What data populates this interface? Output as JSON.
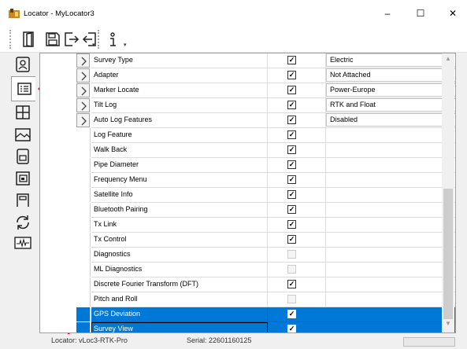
{
  "window": {
    "title": "Locator - MyLocator3",
    "minimize": "–",
    "maximize": "☐",
    "close": "✕"
  },
  "toolbar": {
    "items": [
      {
        "icon": "door-open-icon"
      },
      {
        "icon": "save-icon"
      },
      {
        "icon": "export-icon"
      },
      {
        "icon": "import-icon"
      },
      {
        "icon": "info-icon"
      }
    ]
  },
  "sidebar": {
    "items": [
      {
        "icon": "person-badge-icon"
      },
      {
        "icon": "list-grid-icon",
        "active": true
      },
      {
        "icon": "grid-icon"
      },
      {
        "icon": "map-image-icon"
      },
      {
        "icon": "device-icon"
      },
      {
        "icon": "layers-icon"
      },
      {
        "icon": "card-icon"
      },
      {
        "icon": "refresh-icon"
      },
      {
        "icon": "waveform-icon"
      }
    ]
  },
  "grid": {
    "rows": [
      {
        "name": "Survey Type",
        "checked": true,
        "expandable": true,
        "value": "Electric"
      },
      {
        "name": "Adapter",
        "checked": true,
        "expandable": true,
        "value": "Not Attached"
      },
      {
        "name": "Marker Locate",
        "checked": true,
        "expandable": true,
        "value": "Power-Europe"
      },
      {
        "name": "Tilt Log",
        "checked": true,
        "expandable": true,
        "value": "RTK and Float"
      },
      {
        "name": "Auto Log Features",
        "checked": true,
        "expandable": true,
        "value": "Disabled"
      },
      {
        "name": "Log Feature",
        "checked": true
      },
      {
        "name": "Walk Back",
        "checked": true
      },
      {
        "name": "Pipe Diameter",
        "checked": true
      },
      {
        "name": "Frequency Menu",
        "checked": true
      },
      {
        "name": "Satellite Info",
        "checked": true
      },
      {
        "name": "Bluetooth Pairing",
        "checked": true
      },
      {
        "name": "Tx Link",
        "checked": true
      },
      {
        "name": "Tx Control",
        "checked": true
      },
      {
        "name": "Diagnostics",
        "checked": false,
        "disabled": true
      },
      {
        "name": "ML Diagnostics",
        "checked": false,
        "disabled": true
      },
      {
        "name": "Discrete Fourier Transform (DFT)",
        "checked": true
      },
      {
        "name": "Pitch and Roll",
        "checked": false,
        "disabled": true
      },
      {
        "name": "GPS Deviation",
        "checked": true,
        "selected": true
      },
      {
        "name": "Survey View",
        "checked": true,
        "selected": true,
        "focused": true
      }
    ]
  },
  "annotation_color": "#e81010",
  "statusbar": {
    "locator": "Locator: vLoc3-RTK-Pro",
    "serial": "Serial: 22601160125"
  }
}
